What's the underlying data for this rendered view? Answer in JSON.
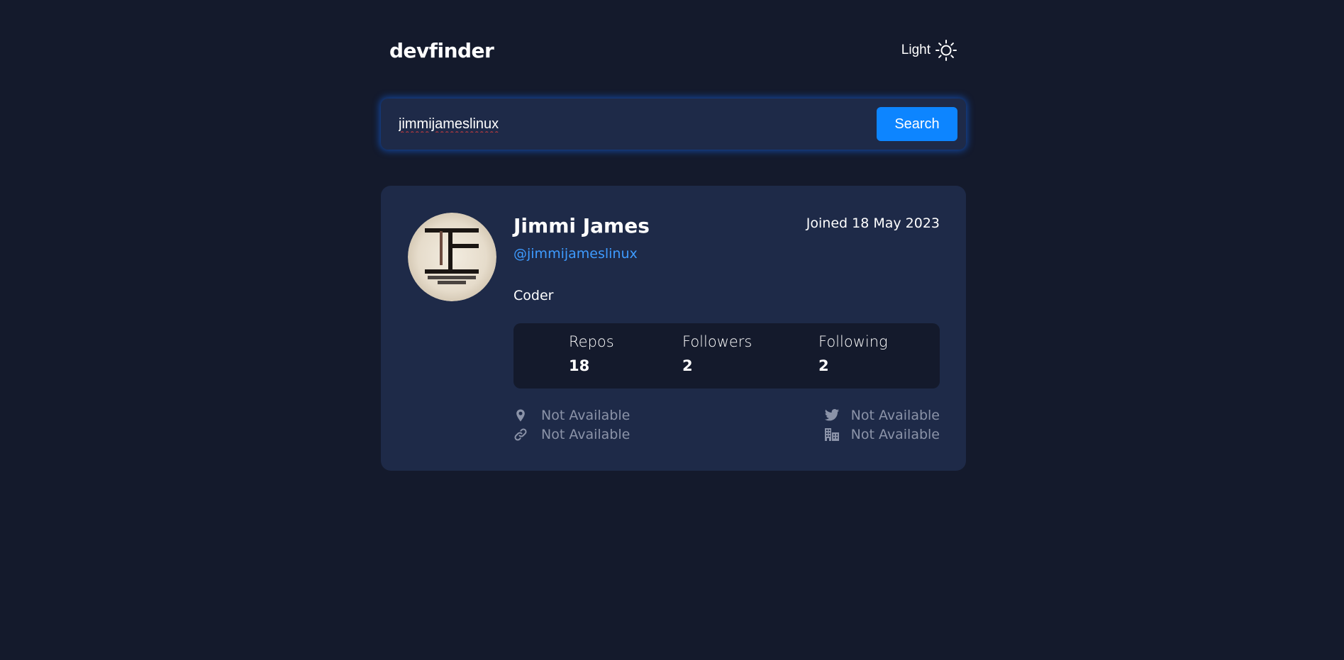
{
  "header": {
    "logo": "devfinder",
    "theme_label": "Light",
    "theme_icon": "sun-icon"
  },
  "search": {
    "value": "jimmijameslinux",
    "placeholder": "",
    "button_label": "Search"
  },
  "profile": {
    "name": "Jimmi James",
    "joined": "Joined 18 May 2023",
    "handle": "@jimmijameslinux",
    "bio": "Coder",
    "stats": {
      "repos_label": "Repos",
      "repos_value": "18",
      "followers_label": "Followers",
      "followers_value": "2",
      "following_label": "Following",
      "following_value": "2"
    },
    "info": {
      "location": {
        "icon": "location-pin-icon",
        "text": "Not Available"
      },
      "website": {
        "icon": "link-icon",
        "text": "Not Available"
      },
      "twitter": {
        "icon": "twitter-icon",
        "text": "Not Available"
      },
      "company": {
        "icon": "building-icon",
        "text": "Not Available"
      }
    }
  },
  "colors": {
    "background": "#141a2c",
    "card": "#1e2a48",
    "accent": "#0d85ff",
    "link": "#3e9bff",
    "muted": "#8b93a8"
  }
}
